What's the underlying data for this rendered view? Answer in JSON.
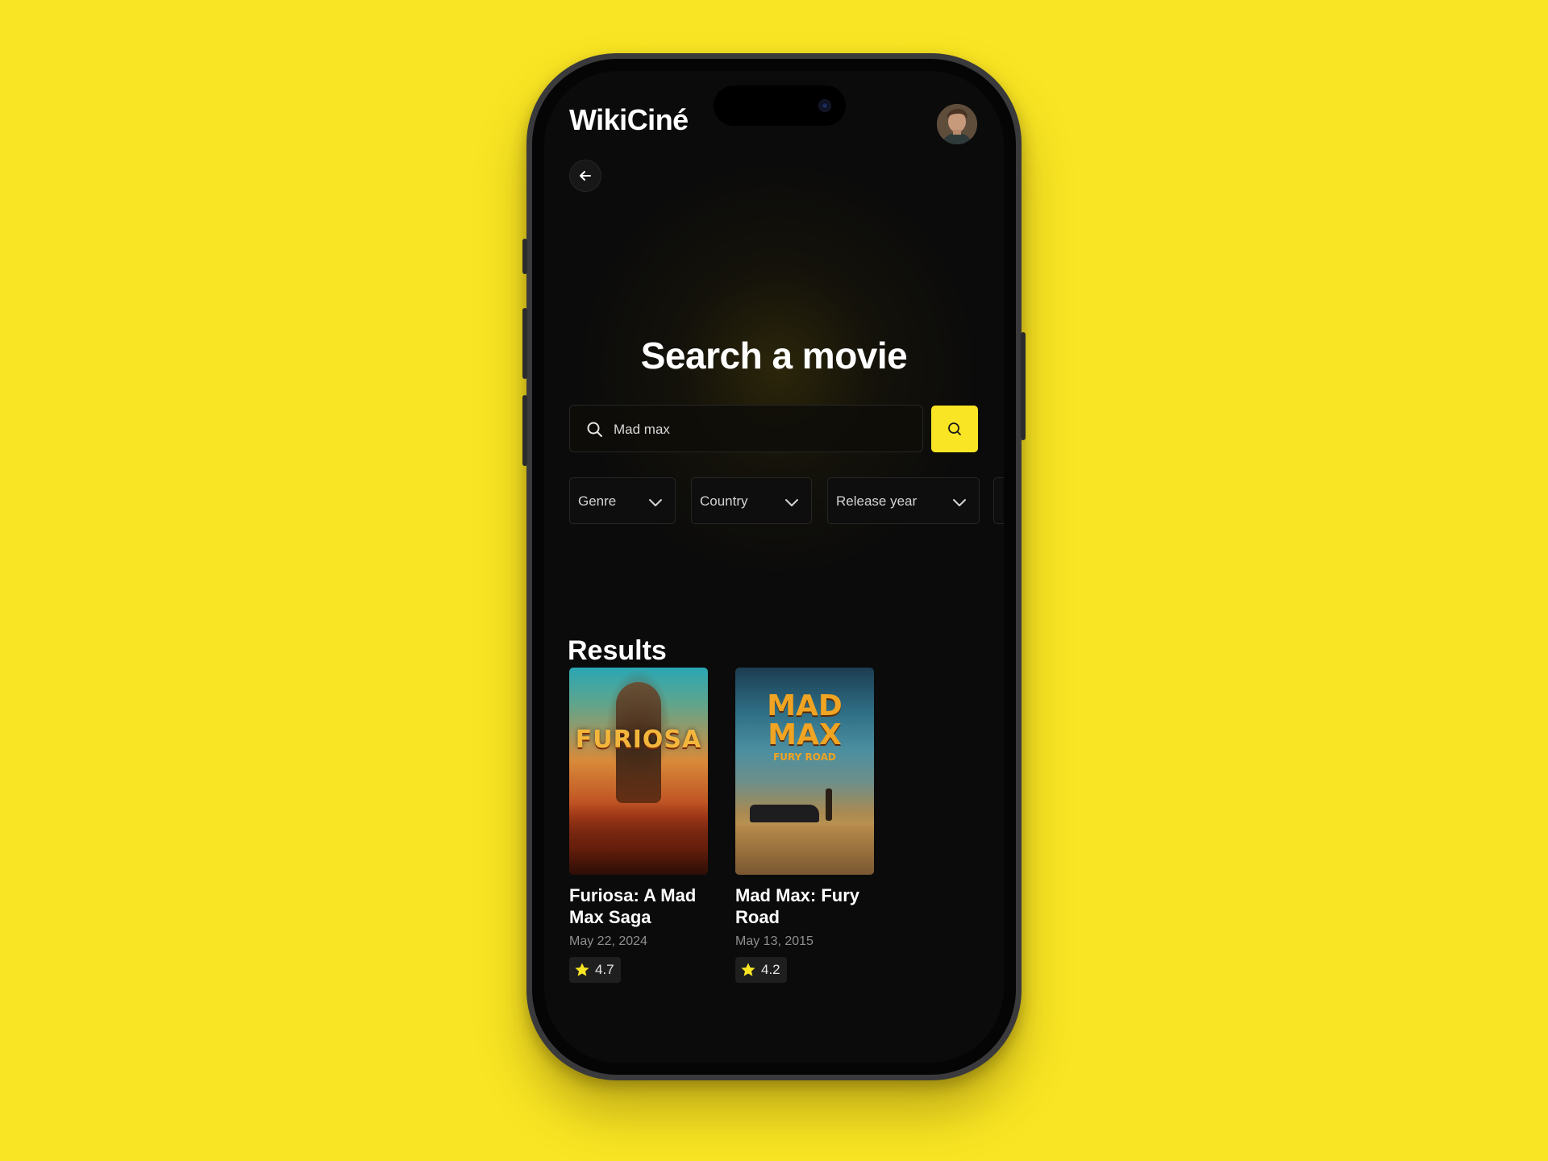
{
  "app": {
    "title": "WikiCiné"
  },
  "page": {
    "heading": "Search a movie",
    "results_title": "Results"
  },
  "search": {
    "value": "Mad max",
    "placeholder": "Search a movie"
  },
  "filters": [
    {
      "label": "Genre"
    },
    {
      "label": "Country"
    },
    {
      "label": "Release year"
    }
  ],
  "results": [
    {
      "title": "Furiosa: A Mad Max Saga",
      "date": "May 22, 2024",
      "rating": "4.7",
      "poster_text": "FURIOSA"
    },
    {
      "title": "Mad Max: Fury Road",
      "date": "May 13, 2015",
      "rating": "4.2",
      "poster_text": "MAD MAX",
      "poster_subtext": "FURY ROAD"
    }
  ],
  "colors": {
    "background": "#f9e523",
    "accent": "#f9e523",
    "screen": "#0b0b0b"
  },
  "icons": [
    "back-arrow-icon",
    "search-icon",
    "chevron-down-icon",
    "star-icon"
  ]
}
